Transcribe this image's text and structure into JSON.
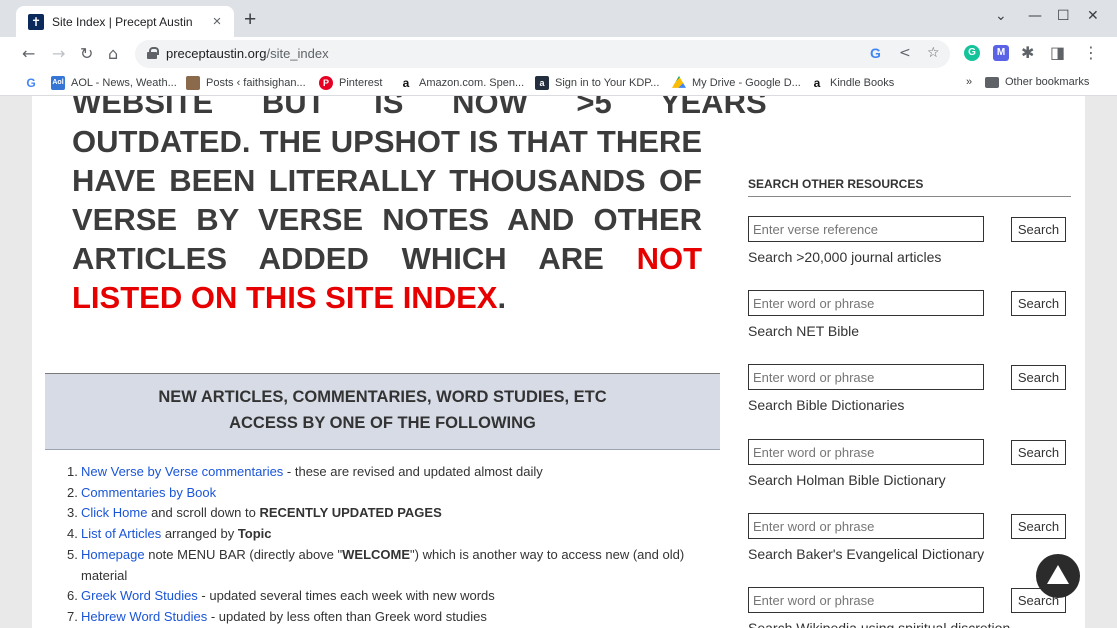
{
  "tab": {
    "title": "Site Index | Precept Austin",
    "close": "×",
    "new_tab": "+"
  },
  "window": {
    "dropdown": "⌄",
    "minimize": "—",
    "maximize": "☐",
    "close": "✕"
  },
  "toolbar": {
    "back": "←",
    "forward": "→",
    "reload": "↻",
    "home": "⌂",
    "url_host": "preceptaustin.org",
    "url_path": "/site_index",
    "menu": "⋮"
  },
  "bookmarks": [
    {
      "label": "",
      "icon": "google-icon"
    },
    {
      "label": "AOL - News, Weath...",
      "icon": "aol-icon"
    },
    {
      "label": "Posts ‹ faithsighan...",
      "icon": "posts-icon"
    },
    {
      "label": "Pinterest",
      "icon": "pinterest-icon"
    },
    {
      "label": "Amazon.com. Spen...",
      "icon": "amazon-icon"
    },
    {
      "label": "Sign in to Your KDP...",
      "icon": "kdp-icon"
    },
    {
      "label": "My Drive - Google D...",
      "icon": "drive-icon"
    },
    {
      "label": "Kindle Books",
      "icon": "amazon-icon"
    }
  ],
  "bookmarks_more": "»",
  "other_bookmarks": "Other bookmarks",
  "notice": {
    "top_partial": "WEBSITE BUT IS NOW >5 YEARS",
    "text_dark": "OUTDATED. THE UPSHOT IS THAT THERE HAVE BEEN LITERALLY THOUSANDS OF VERSE BY VERSE NOTES AND OTHER ARTICLES ADDED WHICH ARE ",
    "text_red": "NOT LISTED ON THIS SITE INDEX",
    "text_end": "."
  },
  "new_articles": {
    "line1": "NEW ARTICLES, COMMENTARIES, WORD STUDIES, ETC",
    "line2": "ACCESS BY ONE OF THE FOLLOWING"
  },
  "list": [
    {
      "num": "1.",
      "link": "New Verse by Verse commentaries",
      "rest": " - these are revised and updated almost daily"
    },
    {
      "num": "2.",
      "link": "Commentaries by Book",
      "rest": ""
    },
    {
      "num": "3.",
      "link": "Click Home",
      "rest": " and scroll down to ",
      "bold": "RECENTLY UPDATED PAGES"
    },
    {
      "num": "4.",
      "link": "List of Articles",
      "rest": " arranged by ",
      "bold": "Topic"
    },
    {
      "num": "5.",
      "link": "Homepage",
      "rest": " note MENU BAR (directly above \"",
      "bold": "WELCOME",
      "rest2": "\") which is another way to access new (and old) material"
    },
    {
      "num": "6.",
      "link": "Greek Word Studies",
      "rest": " - updated several times each week with new words"
    },
    {
      "num": "7.",
      "link": "Hebrew Word Studies",
      "rest": " - updated by less often than Greek word studies"
    }
  ],
  "sidebar": {
    "title": "SEARCH OTHER RESOURCES",
    "button_label": "Search",
    "groups": [
      {
        "placeholder": "Enter verse reference",
        "label": "Search >20,000 journal articles"
      },
      {
        "placeholder": "Enter word or phrase",
        "label": "Search NET Bible"
      },
      {
        "placeholder": "Enter word or phrase",
        "label": "Search Bible Dictionaries"
      },
      {
        "placeholder": "Enter word or phrase",
        "label": "Search Holman Bible Dictionary"
      },
      {
        "placeholder": "Enter word or phrase",
        "label": "Search Baker's Evangelical Dictionary"
      },
      {
        "placeholder": "Enter word or phrase",
        "label": "Search Wikipedia using spiritual discretion"
      }
    ]
  }
}
